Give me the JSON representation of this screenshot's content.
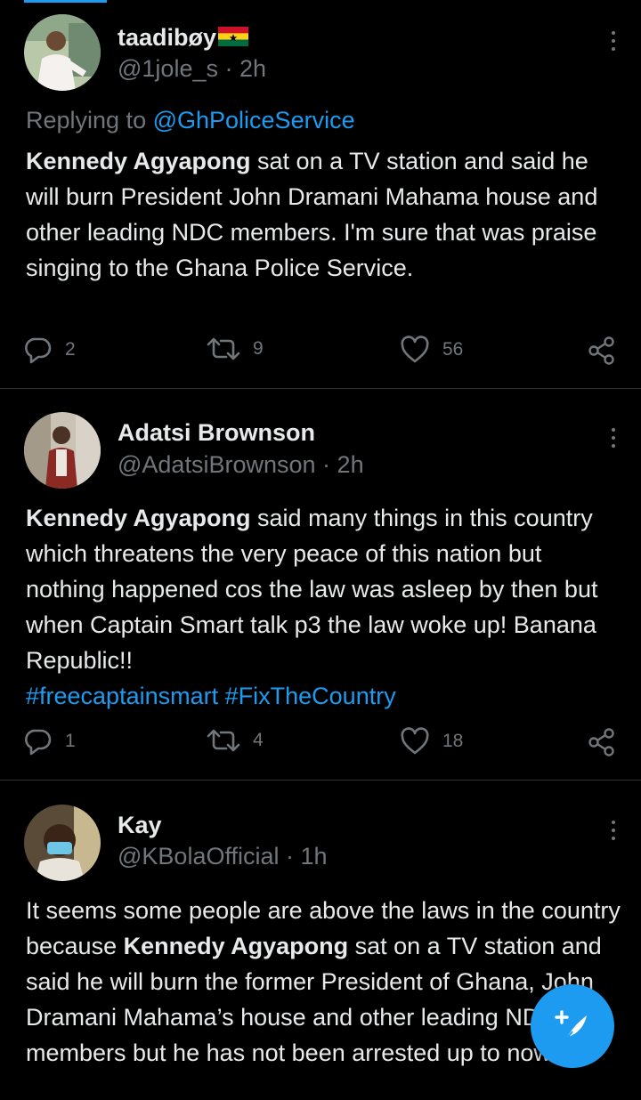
{
  "colors": {
    "accent": "#1d9bf0",
    "background": "#000000",
    "text": "#e7e9ea",
    "muted": "#71767b",
    "divider": "#2f3336"
  },
  "tweets": [
    {
      "name": "taadibøy",
      "name_emoji": "ghana-flag",
      "handle": "@1jole_s",
      "time_sep": "·",
      "time": "2h",
      "replying_prefix": "Replying to ",
      "replying_to": "@GhPoliceService",
      "text_bold": "Kennedy Agyapong",
      "text_rest": " sat on a TV station and said he will burn President John Dramani Mahama house and other leading NDC members. I'm sure that was praise singing to the Ghana Police Service.",
      "replies": "2",
      "retweets": "9",
      "likes": "56"
    },
    {
      "name": "Adatsi Brownson",
      "handle": "@AdatsiBrownson",
      "time_sep": "·",
      "time": "2h",
      "text_bold": "Kennedy Agyapong",
      "text_rest": " said many things in this country which threatens the very peace of this nation but nothing happened cos the law was asleep by then but when Captain Smart talk p3 the law woke up! Banana Republic!!",
      "hashtag1": "#freecaptainsmart",
      "hashtag2": "#FixTheCountry",
      "replies": "1",
      "retweets": "4",
      "likes": "18"
    },
    {
      "name": "Kay",
      "handle": "@KBolaOfficial",
      "time_sep": "·",
      "time": "1h",
      "text_pre": "It seems some people are above the laws in the country because ",
      "text_bold": "Kennedy Agyapong",
      "text_rest": " sat on a TV station and said he will burn the former President of Ghana, John Dramani Mahama’s house and other leading NDC members but he has not been arrested up to now."
    }
  ],
  "icons": [
    "reply-icon",
    "retweet-icon",
    "like-icon",
    "share-icon",
    "more-icon",
    "compose-icon"
  ]
}
